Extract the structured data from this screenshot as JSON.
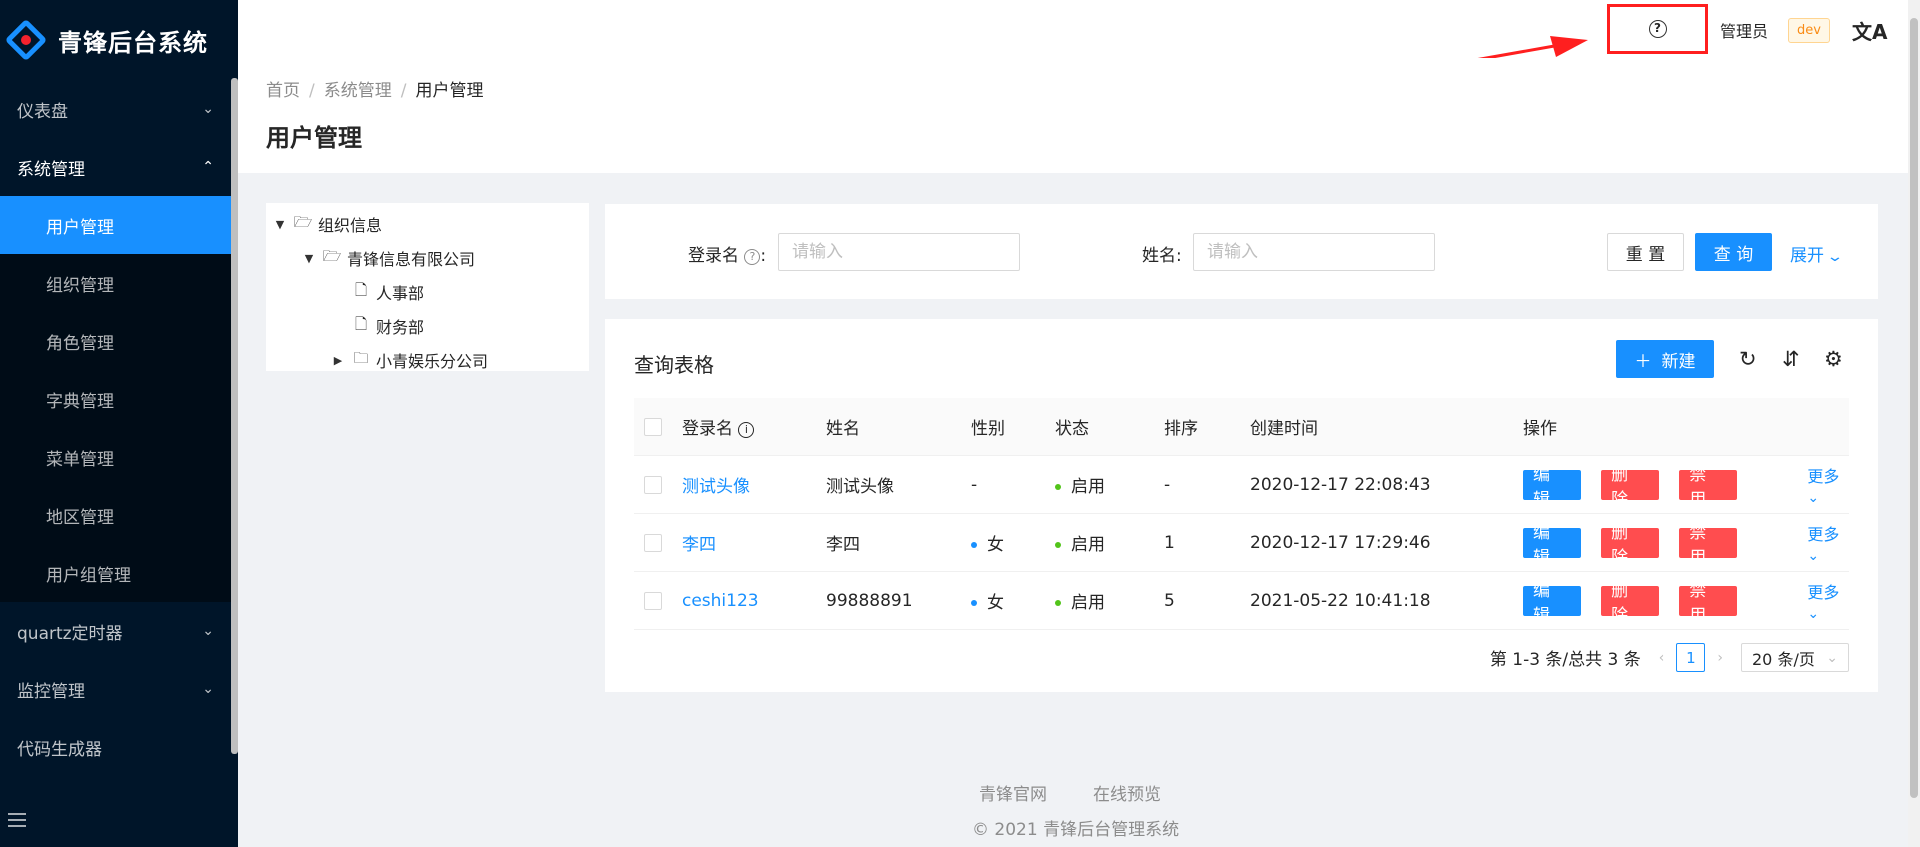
{
  "app": {
    "title": "青锋后台系统"
  },
  "sidebar": {
    "menu": [
      {
        "label": "仪表盘"
      },
      {
        "label": "系统管理"
      },
      {
        "label": "quartz定时器"
      },
      {
        "label": "监控管理"
      },
      {
        "label": "代码生成器"
      }
    ],
    "submenu": [
      {
        "label": "用户管理",
        "active": true
      },
      {
        "label": "组织管理"
      },
      {
        "label": "角色管理"
      },
      {
        "label": "字典管理"
      },
      {
        "label": "菜单管理"
      },
      {
        "label": "地区管理"
      },
      {
        "label": "用户组管理"
      }
    ]
  },
  "header": {
    "help_glyph": "?",
    "admin": "管理员",
    "env": "dev",
    "lang_glyph": "文A"
  },
  "breadcrumb": {
    "home": "首页",
    "parent": "系统管理",
    "current": "用户管理"
  },
  "page_title": "用户管理",
  "tree": {
    "root": "组织信息",
    "company": "青锋信息有限公司",
    "dept1": "人事部",
    "dept2": "财务部",
    "branch": "小青娱乐分公司"
  },
  "search": {
    "login_label": "登录名",
    "login_placeholder": "请输入",
    "name_label": "姓名:",
    "name_placeholder": "请输入",
    "reset": "重 置",
    "query": "查 询",
    "expand": "展开"
  },
  "table": {
    "title": "查询表格",
    "new_button": "新建",
    "columns": {
      "login": "登录名",
      "name": "姓名",
      "gender": "性别",
      "status": "状态",
      "order": "排序",
      "time": "创建时间",
      "ops": "操作"
    },
    "rows": [
      {
        "login": "测试头像",
        "name": "测试头像",
        "gender": "-",
        "status": "启用",
        "order": "-",
        "time": "2020-12-17 22:08:43"
      },
      {
        "login": "李四",
        "name": "李四",
        "gender": "女",
        "status": "启用",
        "order": "1",
        "time": "2020-12-17 17:29:46"
      },
      {
        "login": "ceshi123",
        "name": "99888891",
        "gender": "女",
        "status": "启用",
        "order": "5",
        "time": "2021-05-22 10:41:18"
      }
    ],
    "ops": {
      "edit": "编辑",
      "delete": "删除",
      "disable": "禁用",
      "more": "更多"
    },
    "pagination": {
      "summary": "第 1-3 条/总共 3 条",
      "current": "1",
      "size": "20 条/页"
    }
  },
  "footer": {
    "link1": "青锋官网",
    "link2": "在线预览",
    "copyright": "© 2021 青锋后台管理系统"
  },
  "colors": {
    "primary": "#1890ff",
    "danger": "#ff4d4f",
    "sidebar": "#001529",
    "annotation": "#ff1f1f"
  }
}
